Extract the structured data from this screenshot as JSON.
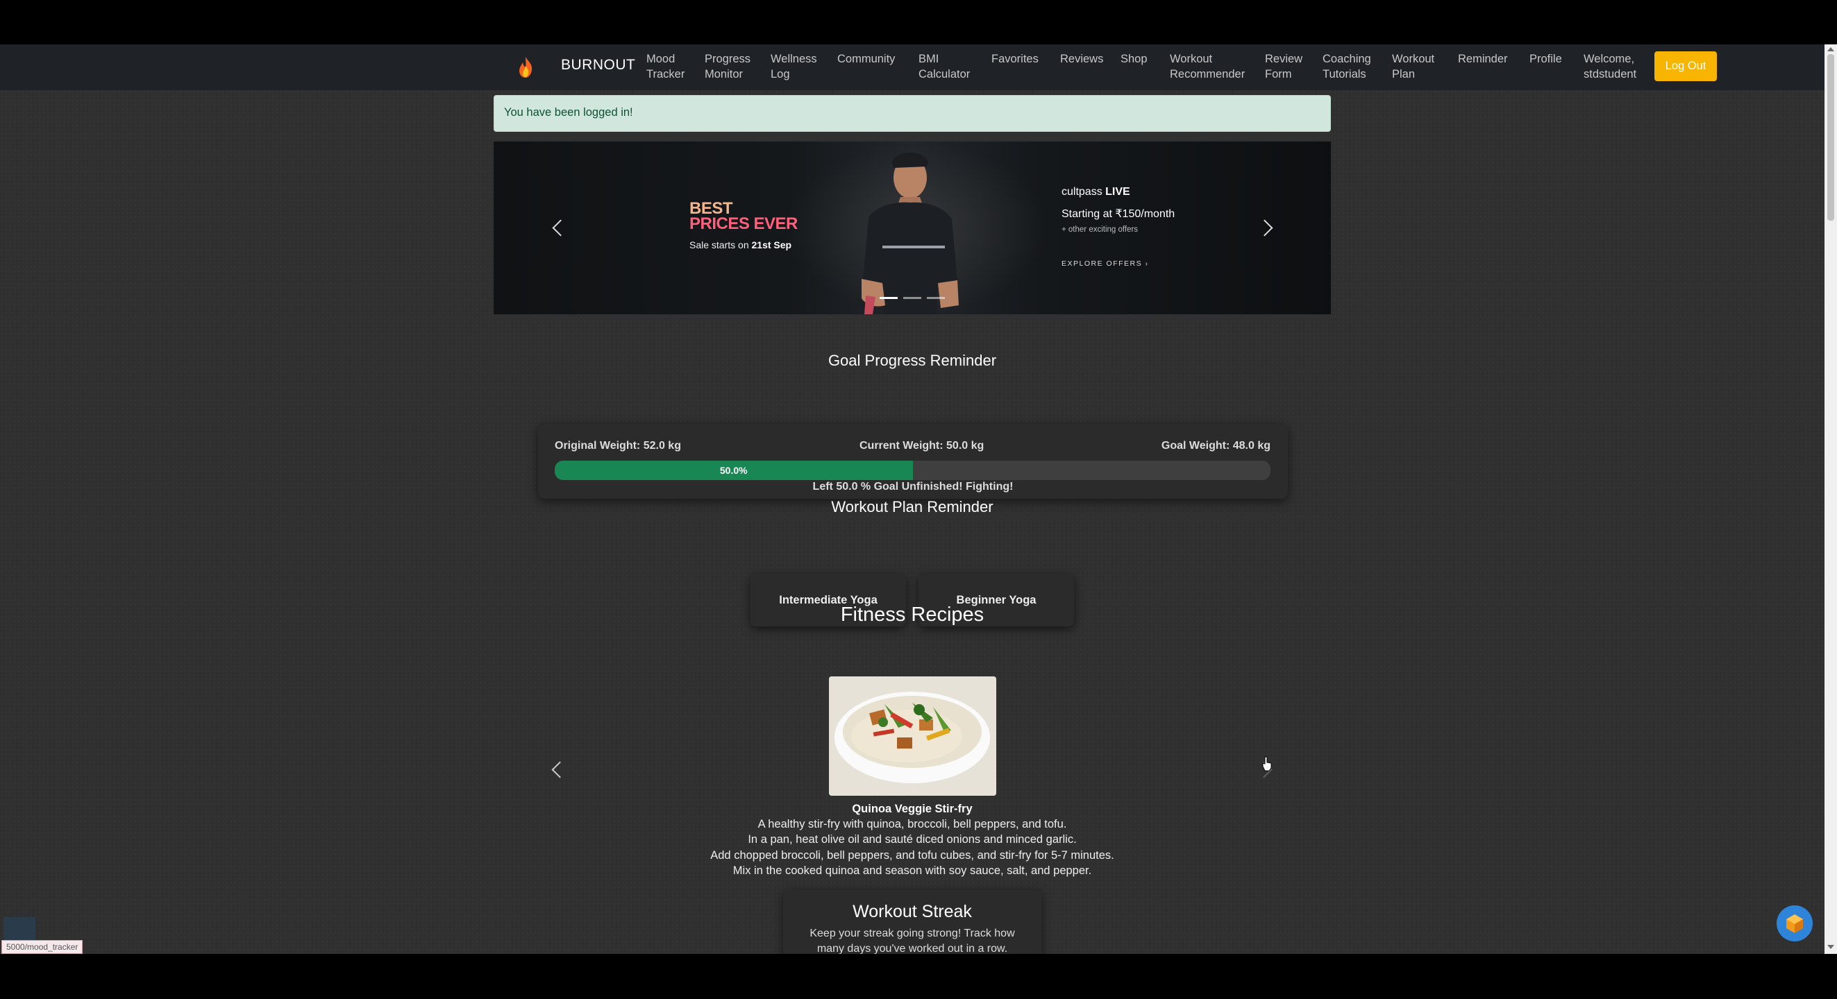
{
  "navbar": {
    "brand": "BURNOUT",
    "items": [
      {
        "label": "Mood\nTracker"
      },
      {
        "label": "Progress\nMonitor"
      },
      {
        "label": "Wellness\nLog"
      },
      {
        "label": "Community"
      },
      {
        "label": "BMI\nCalculator"
      },
      {
        "label": "Favorites"
      },
      {
        "label": "Reviews"
      },
      {
        "label": "Shop"
      },
      {
        "label": "Workout\nRecommender"
      },
      {
        "label": "Review\nForm"
      },
      {
        "label": "Coaching\nTutorials"
      },
      {
        "label": "Workout\nPlan"
      },
      {
        "label": "Reminder"
      },
      {
        "label": "Profile"
      }
    ],
    "welcome": "Welcome,\nstdstudent",
    "logout_label": "Log Out"
  },
  "alert": {
    "message": "You have been logged in!"
  },
  "banner": {
    "headline_line1": "BEST",
    "headline_line2": "PRICES EVER",
    "sale_prefix": "Sale starts on ",
    "sale_date": "21st Sep",
    "brand_plain": "cultpass ",
    "brand_bold": "LIVE",
    "price": "Starting at ₹150/month",
    "other": "+ other exciting offers",
    "explore": "EXPLORE OFFERS ›"
  },
  "goal": {
    "title": "Goal Progress Reminder",
    "original_weight": "Original Weight: 52.0 kg",
    "current_weight": "Current Weight: 50.0 kg",
    "goal_weight": "Goal Weight: 48.0 kg",
    "progress_percent": 50.0,
    "progress_label": "50.0%",
    "message": "Left 50.0 % Goal Unfinished! Fighting!"
  },
  "workout_plan": {
    "title": "Workout Plan Reminder",
    "plans": [
      "Intermediate Yoga",
      "Beginner Yoga"
    ]
  },
  "recipes": {
    "title": "Fitness Recipes",
    "recipe_name": "Quinoa Veggie Stir-fry",
    "lines": [
      "A healthy stir-fry with quinoa, broccoli, bell peppers, and tofu.",
      "In a pan, heat olive oil and sauté diced onions and minced garlic.",
      "Add chopped broccoli, bell peppers, and tofu cubes, and stir-fry for 5-7 minutes.",
      "Mix in the cooked quinoa and season with soy sauce, salt, and pepper."
    ]
  },
  "streak": {
    "title": "Workout Streak",
    "description": "Keep your streak going strong! Track how many days you've worked out in a row."
  },
  "status_bar": {
    "url": "5000/mood_tracker"
  },
  "colors": {
    "navbar_bg": "#1f2226",
    "logout_button": "#f7b400",
    "progress_fill": "#198754",
    "alert_bg": "#d1e7dd"
  }
}
